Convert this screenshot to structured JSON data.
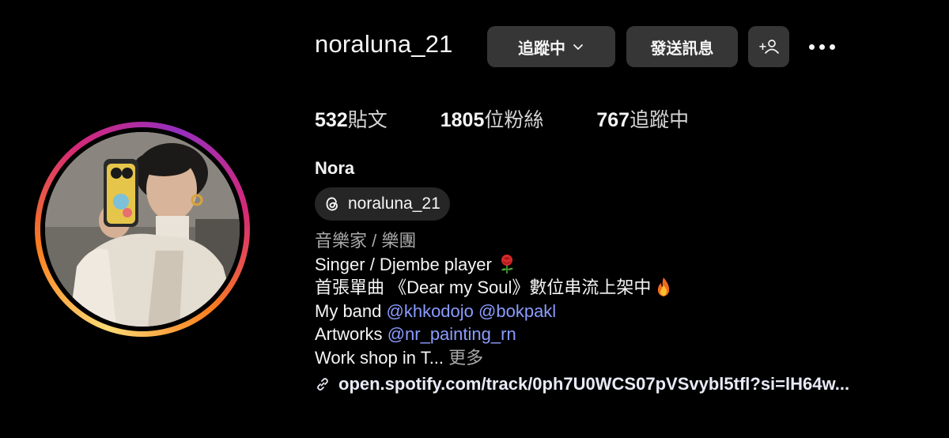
{
  "profile": {
    "username": "noraluna_21",
    "full_name": "Nora",
    "threads_handle": "noraluna_21"
  },
  "actions": {
    "following_label": "追蹤中",
    "message_label": "發送訊息",
    "suggest_label": "+",
    "more_icon": "more-horizontal-icon"
  },
  "stats": {
    "posts_count": "532",
    "posts_label": "貼文",
    "followers_count": "1805",
    "followers_label": "位粉絲",
    "following_count": "767",
    "following_label": "追蹤中"
  },
  "bio": {
    "category": "音樂家 / 樂團",
    "line1": "Singer / Djembe player",
    "line2": "首張單曲 《Dear my Soul》數位串流上架中",
    "line3_prefix": "My band ",
    "mention1": "@khkodojo",
    "mention2": "@bokpakl",
    "line4_prefix": "Artworks ",
    "mention3": "@nr_painting_rn",
    "line5": "Work shop in T...",
    "more_label": "更多",
    "link": "open.spotify.com/track/0ph7U0WCS07pVSvybl5tfl?si=lH64w..."
  },
  "colors": {
    "background": "#000000",
    "button": "#363636",
    "mention": "#8a9cff",
    "muted": "#a8a8a8"
  }
}
